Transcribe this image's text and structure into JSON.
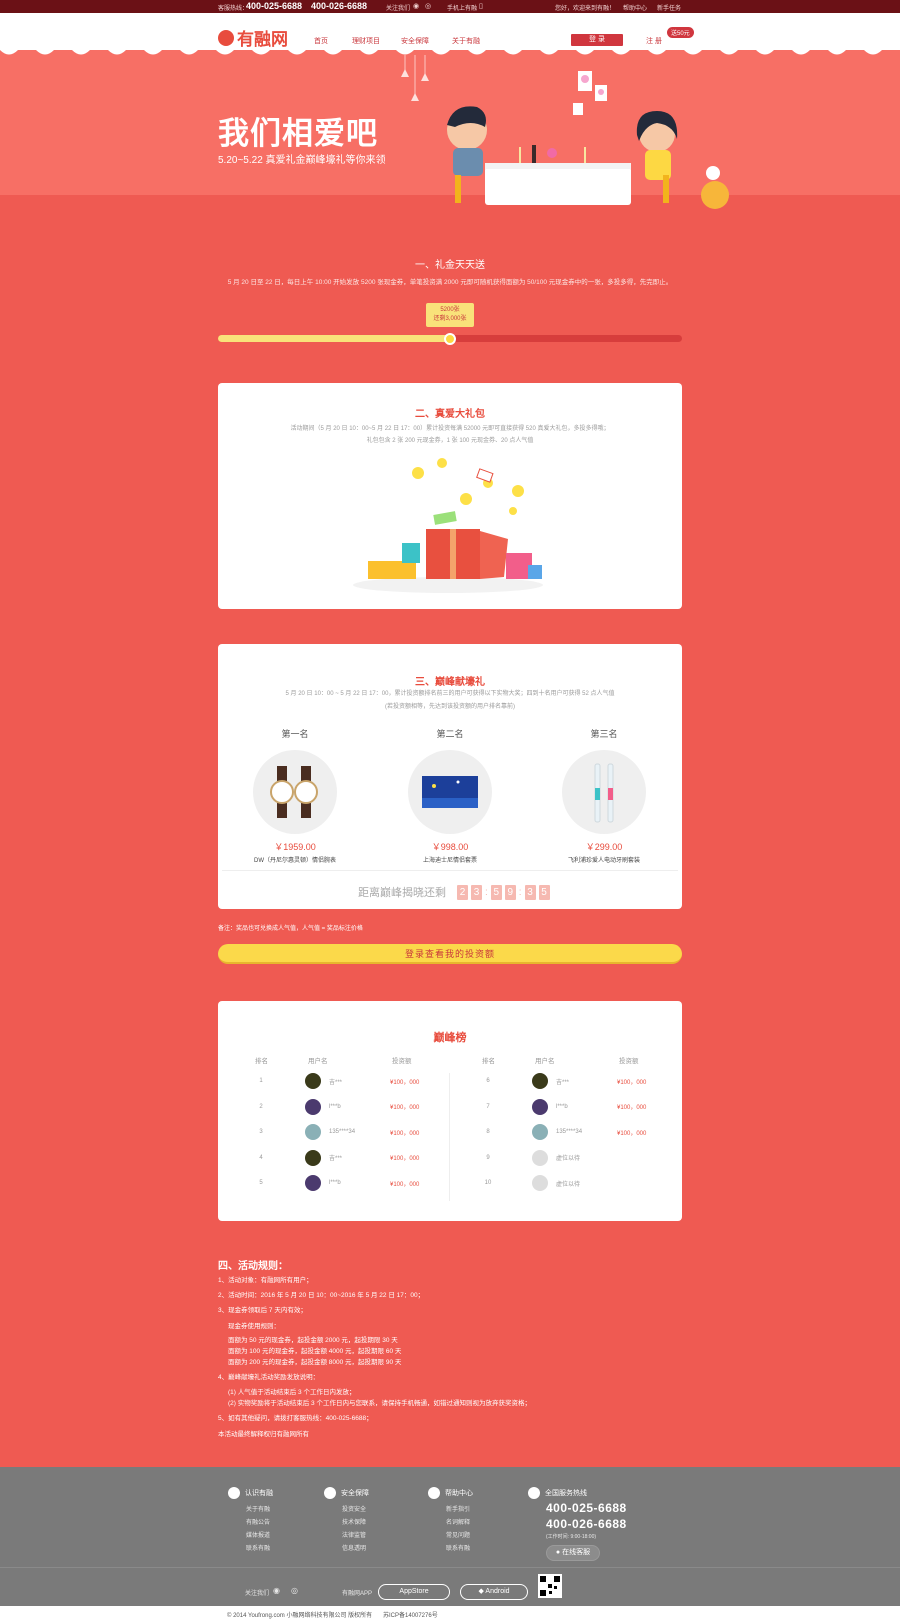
{
  "topbar": {
    "hotline_label": "客服热线：",
    "hotline1": "400-025-6688",
    "hotline2": "400-026-6688",
    "follow": "关注我们",
    "mobile": "手机上有融",
    "greeting": "您好，欢迎来到有融！",
    "help": "帮助中心",
    "newbie": "新手任务"
  },
  "nav": {
    "logo": "有融网",
    "links": [
      "首页",
      "理财项目",
      "安全保障",
      "关于有融"
    ],
    "login": "登 录",
    "register": "注 册",
    "register_badge": "送50元"
  },
  "hero": {
    "title": "我们相爱吧",
    "subtitle": "5.20~5.22 真爱礼金巅峰壕礼等你来领"
  },
  "section1": {
    "title": "一、礼金天天送",
    "desc": "5 月 20 日至 22 日，每日上午 10:00 开始发放 5200 张现金券，单笔投资满 2000 元即可随机获得面额为 50/100 元现金券中的一张，多投多得，先完即止。",
    "tip_line1": "5200张",
    "tip_line2": "还剩3,000张",
    "progress": 0.5
  },
  "section2": {
    "title": "二、真爱大礼包",
    "desc1": "活动期间（5 月 20 日 10：00~5 月 22 日 17：00）累计投资每满 52000 元即可直接获得 520 真爱大礼包，多投多得哦；",
    "desc2": "礼包包含 2 张 200 元现金券，1 张 100 元现金券、20 点人气值"
  },
  "section3": {
    "title": "三、巅峰献壕礼",
    "desc1": "5 月 20 日 10：00 ~ 5 月 22 日 17：00，累计投资额排名前三的用户可获得以下实物大奖；四到十名用户可获得 52 点人气值",
    "desc2": "(若投资额相等，先达到该投资额的用户排名靠前)",
    "prizes": [
      {
        "rank": "第一名",
        "price": "￥1959.00",
        "name": "DW（丹尼尔惠灵顿）情侣腕表"
      },
      {
        "rank": "第二名",
        "price": "￥998.00",
        "name": "上海迪士尼情侣套票"
      },
      {
        "rank": "第三名",
        "price": "￥299.00",
        "name": "飞利浦珍爱人电动牙刷套装"
      }
    ],
    "countdown_label": "距离巅峰揭晓还剩",
    "countdown": [
      "2",
      "3",
      "5",
      "9",
      "3",
      "5"
    ]
  },
  "note": "备注：奖品也可兑换成人气值，人气值 = 奖品标注价格",
  "cta": "登录查看我的投资额",
  "leaderboard": {
    "title": "巅峰榜",
    "headers": [
      "排名",
      "用户名",
      "投资额"
    ],
    "left": [
      {
        "rank": "1",
        "user": "吉***",
        "amount": "¥100，000",
        "color": "#3a3a1a"
      },
      {
        "rank": "2",
        "user": "l***b",
        "amount": "¥100，000",
        "color": "#4b3a6e"
      },
      {
        "rank": "3",
        "user": "135****34",
        "amount": "¥100，000",
        "color": "#8ab0b6"
      },
      {
        "rank": "4",
        "user": "吉***",
        "amount": "¥100，000",
        "color": "#3a3a1a"
      },
      {
        "rank": "5",
        "user": "l***b",
        "amount": "¥100，000",
        "color": "#4b3a6e"
      }
    ],
    "right": [
      {
        "rank": "6",
        "user": "吉***",
        "amount": "¥100，000",
        "color": "#3a3a1a"
      },
      {
        "rank": "7",
        "user": "l***b",
        "amount": "¥100，000",
        "color": "#4b3a6e"
      },
      {
        "rank": "8",
        "user": "135****34",
        "amount": "¥100，000",
        "color": "#8ab0b6"
      },
      {
        "rank": "9",
        "user": "虚位以待",
        "amount": "",
        "color": "#dddddd"
      },
      {
        "rank": "10",
        "user": "虚位以待",
        "amount": "",
        "color": "#dddddd"
      }
    ]
  },
  "rules": {
    "title": "四、活动规则：",
    "lines": [
      "1、活动对象：有融网所有用户；",
      "2、活动时间：2016 年 5 月 20 日 10：00~2016 年 5 月 22 日 17：00；",
      "3、现金券领取后 7 天内有效；",
      "现金券使用规则：",
      "面额为 50 元的现金券，起投金额 2000 元，起投期限 30 天",
      "面额为 100 元的现金券，起投金额 4000 元，起投期限 60 天",
      "面额为 200 元的现金券，起投金额 8000 元，起投期限 90 天",
      "4、巅峰献壕礼活动奖励发放说明：",
      "(1) 人气值于活动结束后 3 个工作日内发放；",
      "(2) 实物奖励将于活动结束后 3 个工作日内与您联系，请保持手机畅通，如错过通知则视为放弃获奖资格；",
      "5、如有其他疑问，请拨打客服热线：400-025-6688；",
      "本活动最终解释权归有融网所有"
    ]
  },
  "footer": {
    "cols": [
      {
        "title": "认识有融",
        "links": [
          "关于有融",
          "有融公告",
          "媒体报道",
          "联系有融"
        ]
      },
      {
        "title": "安全保障",
        "links": [
          "投资安全",
          "技术保障",
          "法律监管",
          "信息透明"
        ]
      },
      {
        "title": "帮助中心",
        "links": [
          "新手指引",
          "名词解释",
          "常见问题",
          "联系有融"
        ]
      }
    ],
    "service_title": "全国服务热线",
    "hotline1": "400-025-6688",
    "hotline2": "400-026-6688",
    "hours": "(工作时间: 9:00-18:00)",
    "online": "在线客服",
    "follow": "关注我们",
    "app_label": "有融网APP",
    "appstore": "AppStore",
    "android": "Android"
  },
  "copyright": "© 2014 Youfrong.com 小融网络科技有限公司 版权所有",
  "icp": "苏ICP备14007276号"
}
